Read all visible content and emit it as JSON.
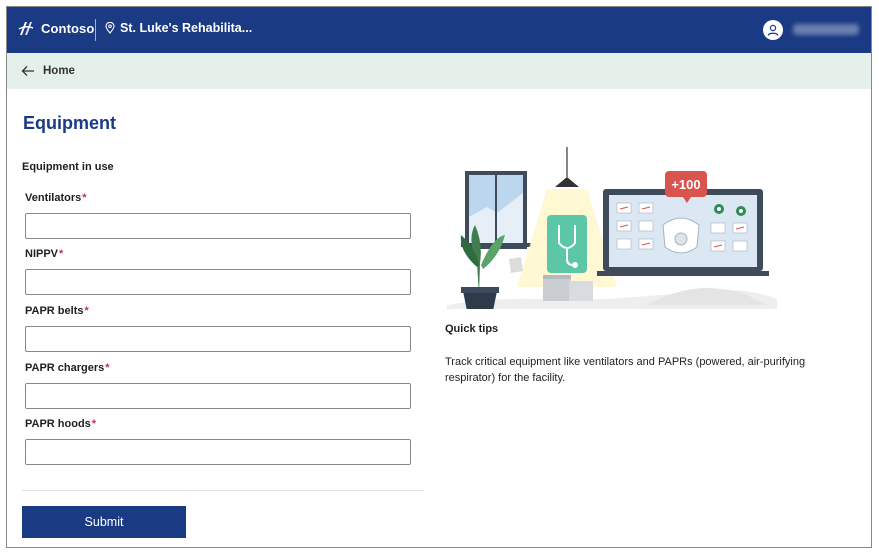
{
  "header": {
    "brand": "Contoso",
    "site": "St. Luke's Rehabilita...",
    "user_name": ""
  },
  "breadcrumb": {
    "back_label": "Home"
  },
  "main": {
    "title": "Equipment",
    "section": "Equipment in use",
    "required_mark": "*",
    "fields": [
      {
        "label": "Ventilators",
        "value": ""
      },
      {
        "label": "NIPPV",
        "value": ""
      },
      {
        "label": "PAPR belts",
        "value": ""
      },
      {
        "label": "PAPR chargers",
        "value": ""
      },
      {
        "label": "PAPR hoods",
        "value": ""
      }
    ],
    "submit_label": "Submit"
  },
  "tips": {
    "badge": "+100",
    "title": "Quick tips",
    "text": "Track critical equipment like ventilators and PAPRs (powered, air-purifying respirator) for the facility."
  },
  "colors": {
    "header_bg": "#1b3a84",
    "breadcrumb_bg": "#e6f0ea",
    "accent": "#1b3a84",
    "required": "#c4314b",
    "badge": "#d9534f"
  },
  "icons": {
    "brand": "contoso-logo-icon",
    "site": "location-pin-icon",
    "user": "person-icon",
    "back": "arrow-left-icon"
  }
}
